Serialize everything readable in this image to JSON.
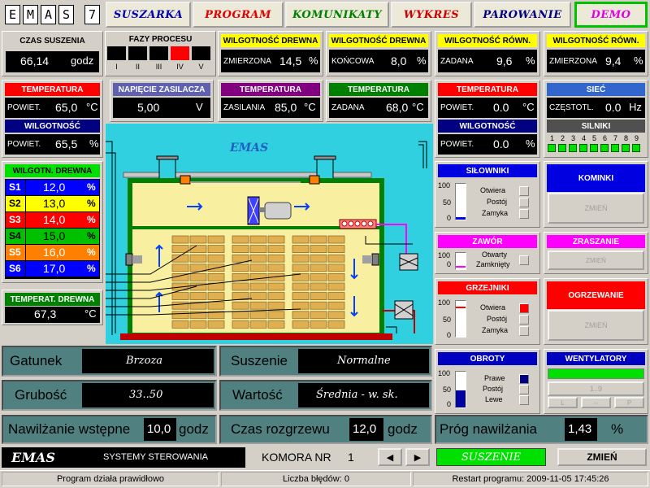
{
  "logo": {
    "letters": [
      "E",
      "M",
      "A",
      "S",
      "7"
    ]
  },
  "tabs": [
    {
      "label": "SUSZARKA",
      "color": "#0000aa"
    },
    {
      "label": "PROGRAM",
      "color": "#e00000"
    },
    {
      "label": "KOMUNIKATY",
      "color": "#008000"
    },
    {
      "label": "WYKRES",
      "color": "#cc0000"
    },
    {
      "label": "PAROWANIE",
      "color": "#000080"
    },
    {
      "label": "DEMO",
      "color": "#e000e0"
    }
  ],
  "czas_suszenia": {
    "title": "CZAS SUSZENIA",
    "value": "66,14",
    "unit": "godz"
  },
  "fazy": {
    "title": "FAZY PROCESU",
    "labels": [
      "I",
      "II",
      "III",
      "IV",
      "V"
    ],
    "active_index": 3,
    "active_color": "#ff0000"
  },
  "wilg_drewna_zmierzona": {
    "title": "WILGOTNOŚĆ DREWNA",
    "label": "ZMIERZONA",
    "value": "14,5",
    "unit": "%"
  },
  "wilg_drewna_koncowa": {
    "title": "WILGOTNOŚĆ DREWNA",
    "label": "KOŃCOWA",
    "value": "8,0",
    "unit": "%"
  },
  "wilg_row_zadana": {
    "title": "WILGOTNOŚĆ RÓWN.",
    "label": "ZADANA",
    "value": "9,6",
    "unit": "%"
  },
  "wilg_row_zmierzona": {
    "title": "WILGOTNOŚĆ RÓWN.",
    "label": "ZMIERZONA",
    "value": "9,4",
    "unit": "%"
  },
  "temp_wilg": {
    "title_temp": "TEMPERATURA",
    "label_temp": "POWIET.",
    "value_temp": "65,0",
    "unit_temp": "°C",
    "title_wilg": "WILGOTNOŚĆ",
    "label_wilg": "POWIET.",
    "value_wilg": "65,5",
    "unit_wilg": "%"
  },
  "napiecie": {
    "title": "NAPIĘCIE ZASILACZA",
    "value": "5,00",
    "unit": "V"
  },
  "temp_zasilania": {
    "title": "TEMPERATURA",
    "label": "ZASILANIA",
    "value": "85,0",
    "unit": "°C"
  },
  "temp_zadana": {
    "title": "TEMPERATURA",
    "label": "ZADANA",
    "value": "68,0",
    "unit": "°C"
  },
  "temp_wilg_right": {
    "title_temp": "TEMPERATURA",
    "label_temp": "POWIET.",
    "value_temp": "0.0",
    "unit_temp": "°C",
    "title_wilg": "WILGOTNOŚĆ",
    "label_wilg": "POWIET.",
    "value_wilg": "0.0",
    "unit_wilg": "%"
  },
  "siec": {
    "title": "SIEĆ",
    "label": "CZĘSTOTL.",
    "value": "0.0",
    "unit": "Hz",
    "silniki_title": "SILNIKI",
    "silniki_numbers": [
      "1",
      "2",
      "3",
      "4",
      "5",
      "6",
      "7",
      "8",
      "9"
    ]
  },
  "wilg_drewna_sensors": {
    "title": "WILGOTN. DREWNA",
    "rows": [
      {
        "label": "S1",
        "value": "12,0",
        "unit": "%",
        "bg": "#0000ff",
        "fg": "#ffffff"
      },
      {
        "label": "S2",
        "value": "13,0",
        "unit": "%",
        "bg": "#ffff00",
        "fg": "#000000"
      },
      {
        "label": "S3",
        "value": "14,0",
        "unit": "%",
        "bg": "#ff0000",
        "fg": "#ffffff"
      },
      {
        "label": "S4",
        "value": "15,0",
        "unit": "%",
        "bg": "#00c000",
        "fg": "#000000"
      },
      {
        "label": "S5",
        "value": "16,0",
        "unit": "%",
        "bg": "#ff8000",
        "fg": "#ffffff"
      },
      {
        "label": "S6",
        "value": "17,0",
        "unit": "%",
        "bg": "#0000ff",
        "fg": "#ffffff"
      }
    ]
  },
  "temp_drewna": {
    "title": "TEMPERAT. DREWNA",
    "value": "67,3",
    "unit": "°C"
  },
  "diagram": {
    "title": "EMAS"
  },
  "silowniki": {
    "title": "SIŁOWNIKI",
    "scale": [
      "100",
      "50",
      "0"
    ],
    "options": [
      "Otwiera",
      "Postój",
      "Zamyka"
    ],
    "level": 0.05
  },
  "kominki": {
    "title": "KOMINKI",
    "button": "ZMIEŃ"
  },
  "zawor": {
    "title": "ZAWÓR",
    "scale": [
      "100",
      "0"
    ],
    "options": [
      "Otwarty",
      "Zamknięty"
    ],
    "level": 0.1
  },
  "zraszanie": {
    "title": "ZRASZANIE",
    "button": "ZMIEŃ"
  },
  "grzejniki": {
    "title": "GRZEJNIKI",
    "scale": [
      "100",
      "50",
      "0"
    ],
    "options": [
      "Otwiera",
      "Postój",
      "Zamyka"
    ],
    "level": 0.9,
    "active_index": 0
  },
  "ogrzewanie": {
    "title": "OGRZEWANIE",
    "button": "ZMIEŃ"
  },
  "obroty": {
    "title": "OBROTY",
    "scale": [
      "100",
      "50",
      "0"
    ],
    "options": [
      "Prawe",
      "Postój",
      "Lewe"
    ],
    "level": 0.45,
    "active_index": 0
  },
  "wentylatory": {
    "title": "WENTYLATORY",
    "level_label": "1..9",
    "buttons": [
      "L",
      "--",
      "P"
    ]
  },
  "gatunek": {
    "label": "Gatunek",
    "value": "Brzoza"
  },
  "suszenie": {
    "label": "Suszenie",
    "value": "Normalne"
  },
  "grubosc": {
    "label": "Grubość",
    "value": "33..50"
  },
  "wartosc": {
    "label": "Wartość",
    "value": "Średnia - w. sk."
  },
  "nawilzanie": {
    "label": "Nawilżanie wstępne",
    "value": "10,0",
    "unit": "godz"
  },
  "rozgrzew": {
    "label": "Czas rozgrzewu",
    "value": "12,0",
    "unit": "godz"
  },
  "prog": {
    "label": "Próg nawilżania",
    "value": "1,43",
    "unit": "%"
  },
  "bottom": {
    "logo": "EMAS",
    "company": "SYSTEMY STEROWANIA",
    "komora_label": "KOMORA NR",
    "komora_value": "1",
    "prev": "◀",
    "next": "▶",
    "status": "SUSZENIE",
    "change": "ZMIEŃ"
  },
  "statusbar": {
    "left": "Program działa prawidłowo",
    "middle": "Liczba błędów: 0",
    "right": "Restart programu: 2009-11-05 17:45:26"
  }
}
